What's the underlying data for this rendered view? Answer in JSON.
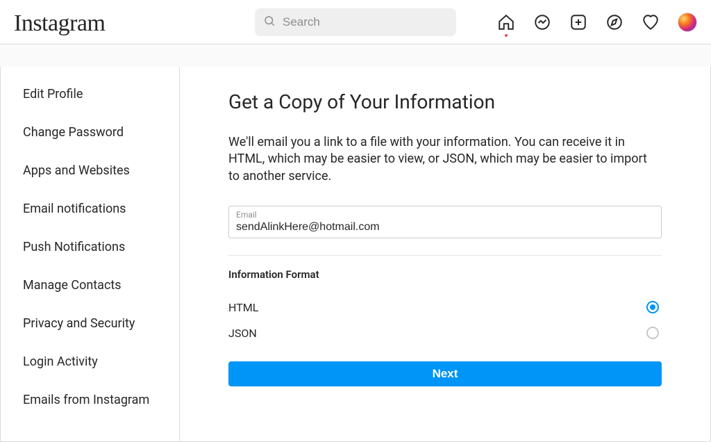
{
  "brand": "Instagram",
  "search": {
    "placeholder": "Search"
  },
  "sidebar": {
    "items": [
      {
        "label": "Edit Profile"
      },
      {
        "label": "Change Password"
      },
      {
        "label": "Apps and Websites"
      },
      {
        "label": "Email notifications"
      },
      {
        "label": "Push Notifications"
      },
      {
        "label": "Manage Contacts"
      },
      {
        "label": "Privacy and Security"
      },
      {
        "label": "Login Activity"
      },
      {
        "label": "Emails from Instagram"
      }
    ]
  },
  "page": {
    "title": "Get a Copy of Your Information",
    "description": "We'll email you a link to a file with your information. You can receive it in HTML, which may be easier to view, or JSON, which may be easier to import to another service.",
    "email_label": "Email",
    "email_value": "sendAlinkHere@hotmail.com",
    "format_heading": "Information Format",
    "formats": [
      {
        "label": "HTML",
        "checked": true
      },
      {
        "label": "JSON",
        "checked": false
      }
    ],
    "next_label": "Next"
  },
  "colors": {
    "accent": "#0095f6",
    "border": "#dbdbdb"
  }
}
